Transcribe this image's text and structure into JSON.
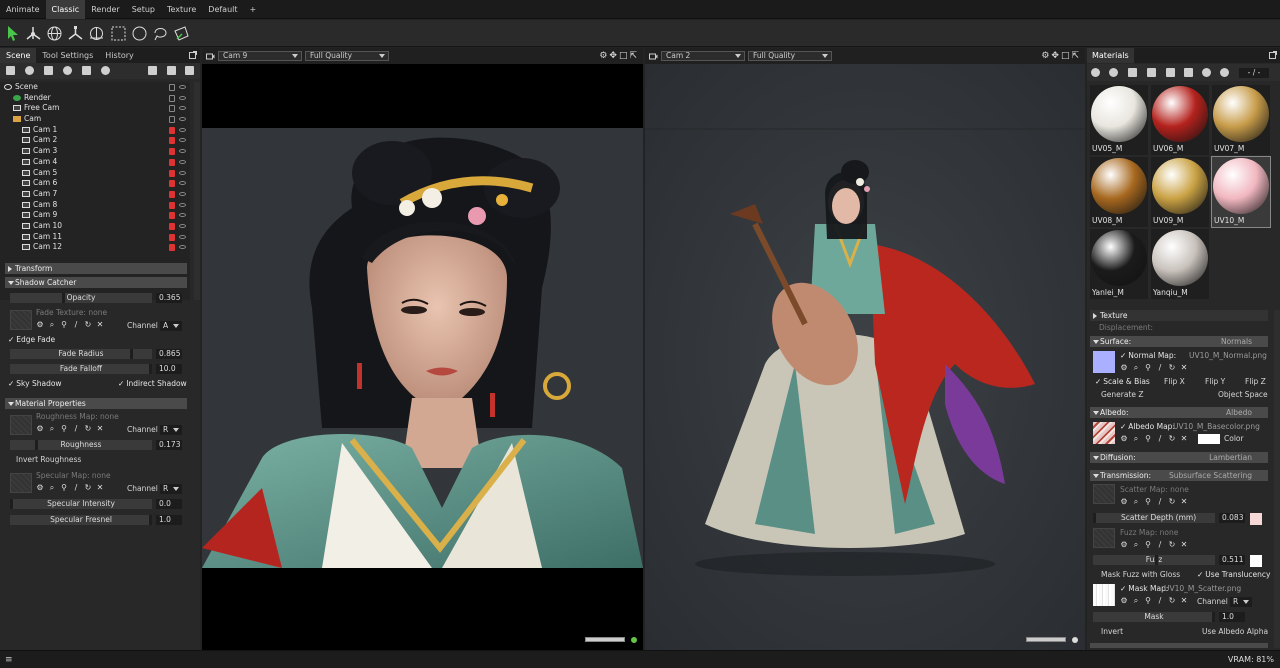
{
  "workspace_tabs": [
    "Animate",
    "Classic",
    "Render",
    "Setup",
    "Texture",
    "Default",
    "+"
  ],
  "left_panel": {
    "tabs": [
      "Scene",
      "Tool Settings",
      "History"
    ],
    "tree": [
      {
        "label": "Scene",
        "indent": 0,
        "icon": "scene-icon"
      },
      {
        "label": "Render",
        "indent": 1,
        "icon": "gear-icon"
      },
      {
        "label": "Free Cam",
        "indent": 1,
        "icon": "camera-icon"
      },
      {
        "label": "Cam",
        "indent": 1,
        "icon": "folder-icon"
      },
      {
        "label": "Cam 1",
        "indent": 2,
        "icon": "camera-icon",
        "locked": true
      },
      {
        "label": "Cam 2",
        "indent": 2,
        "icon": "camera-icon",
        "locked": true
      },
      {
        "label": "Cam 3",
        "indent": 2,
        "icon": "camera-icon",
        "locked": true
      },
      {
        "label": "Cam 4",
        "indent": 2,
        "icon": "camera-icon",
        "locked": true
      },
      {
        "label": "Cam 5",
        "indent": 2,
        "icon": "camera-icon",
        "locked": true
      },
      {
        "label": "Cam 6",
        "indent": 2,
        "icon": "camera-icon",
        "locked": true
      },
      {
        "label": "Cam 7",
        "indent": 2,
        "icon": "camera-icon",
        "locked": true
      },
      {
        "label": "Cam 8",
        "indent": 2,
        "icon": "camera-icon",
        "locked": true
      },
      {
        "label": "Cam 9",
        "indent": 2,
        "icon": "camera-icon",
        "locked": true
      },
      {
        "label": "Cam 10",
        "indent": 2,
        "icon": "camera-icon",
        "locked": true
      },
      {
        "label": "Cam 11",
        "indent": 2,
        "icon": "camera-icon",
        "locked": true
      },
      {
        "label": "Cam 12",
        "indent": 2,
        "icon": "camera-icon",
        "locked": true
      }
    ],
    "transform": "Transform",
    "shadow_catcher": {
      "title": "Shadow Catcher",
      "opacity_label": "Opacity",
      "opacity_value": "0.365",
      "fade_texture": "Fade Texture: none",
      "channel_label": "Channel",
      "channel_value": "A",
      "edge_fade": "Edge Fade",
      "fade_radius_label": "Fade Radius",
      "fade_radius_value": "0.865",
      "fade_falloff_label": "Fade Falloff",
      "fade_falloff_value": "10.0",
      "sky_shadow": "Sky Shadow",
      "indirect_shadow": "Indirect Shadow"
    },
    "material_properties": {
      "title": "Material Properties",
      "roughness_map": "Roughness Map: none",
      "channel_label": "Channel",
      "channel_value": "R",
      "roughness_label": "Roughness",
      "roughness_value": "0.173",
      "invert_roughness": "Invert Roughness",
      "specular_map": "Specular Map: none",
      "channel2_label": "Channel",
      "channel2_value": "R",
      "specular_intensity_label": "Specular Intensity",
      "specular_intensity_value": "0.0",
      "specular_fresnel_label": "Specular Fresnel",
      "specular_fresnel_value": "1.0"
    }
  },
  "viewport_left": {
    "camera": "Cam 9",
    "quality": "Full Quality"
  },
  "viewport_right": {
    "camera": "Cam 2",
    "quality": "Full Quality"
  },
  "right_panel": {
    "tab": "Materials",
    "page_indicator": "- / -",
    "materials": [
      {
        "name": "UV05_M",
        "color": "#e9e6df"
      },
      {
        "name": "UV06_M",
        "color": "#b4221d"
      },
      {
        "name": "UV07_M",
        "color": "#c79c4a"
      },
      {
        "name": "UV08_M",
        "color": "#a7681f"
      },
      {
        "name": "UV09_M",
        "color": "#caa244"
      },
      {
        "name": "UV10_M",
        "color": "#f1b7c0",
        "selected": true
      },
      {
        "name": "Yanlei_M",
        "color": "#1b1b1b"
      },
      {
        "name": "Yanqiu_M",
        "color": "#c9c2bc"
      }
    ],
    "texture": "Texture",
    "displacement": "Displacement:",
    "surface": {
      "title": "Surface:",
      "mode": "Normals",
      "normal_map": "Normal Map:",
      "normal_file": "UV10_M_Normal.png",
      "scale_bias": "Scale & Bias",
      "flip_x": "Flip X",
      "flip_y": "Flip Y",
      "flip_z": "Flip Z",
      "generate_z": "Generate Z",
      "object_space": "Object Space"
    },
    "albedo": {
      "title": "Albedo:",
      "mode": "Albedo",
      "map": "Albedo Map:",
      "file": "UV10_M_Basecolor.png",
      "color_label": "Color"
    },
    "diffusion": {
      "title": "Diffusion:",
      "mode": "Lambertian"
    },
    "transmission": {
      "title": "Transmission:",
      "mode": "Subsurface Scattering",
      "scatter_map": "Scatter Map: none",
      "scatter_depth_label": "Scatter Depth (mm)",
      "scatter_depth_value": "0.083",
      "fuzz_map": "Fuzz Map: none",
      "fuzz_label": "Fuzz",
      "fuzz_value": "0.511",
      "mask_fuzz": "Mask Fuzz with Gloss",
      "use_translucency": "Use Translucency",
      "mask_map": "Mask Map:",
      "mask_file": "UV10_M_Scatter.png",
      "channel_label": "Channel",
      "channel_value": "R",
      "mask_label": "Mask",
      "mask_value": "1.0",
      "invert": "Invert",
      "use_albedo_alpha": "Use Albedo Alpha"
    }
  },
  "status": {
    "vram": "VRAM: 81%"
  },
  "colors": {
    "accent": "#3c8fd8",
    "status_green": "#65c545",
    "lock_red": "#d33333",
    "tool_green": "#4bc44b"
  }
}
